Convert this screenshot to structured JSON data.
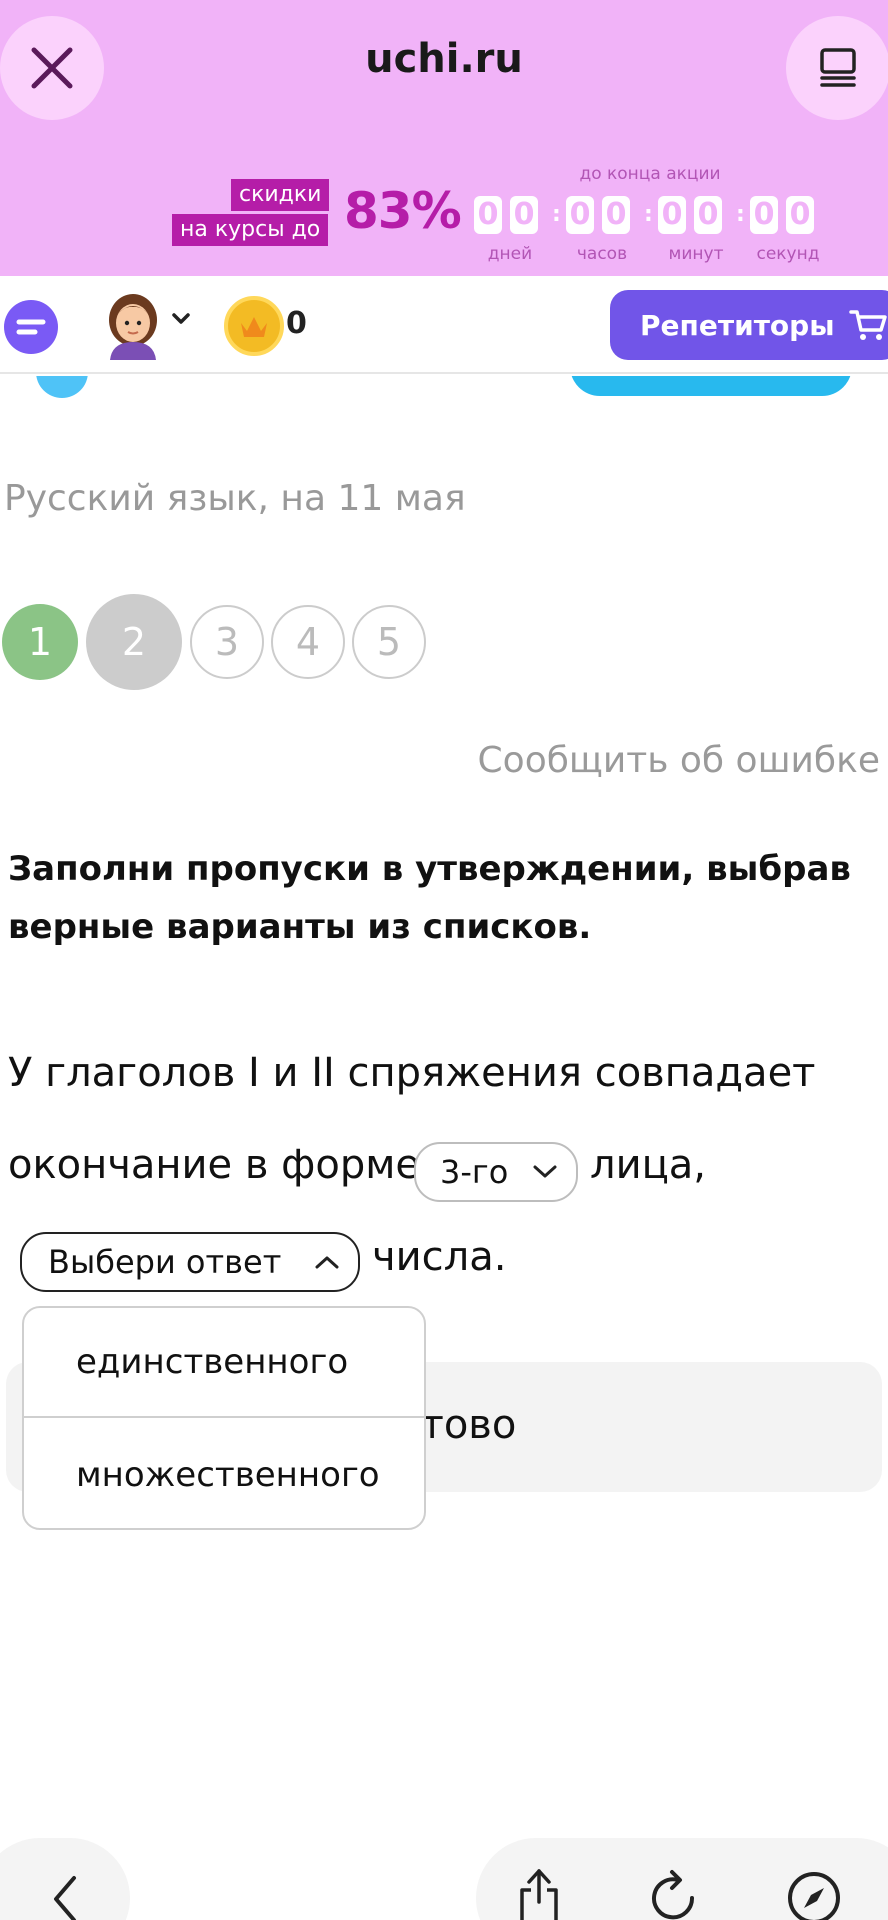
{
  "header": {
    "site": "uchi.ru"
  },
  "promo": {
    "tag_line1": "скидки",
    "tag_line2": "на курсы до",
    "percent": "83%",
    "timer_caption": "до конца акции",
    "digits": [
      "0",
      "0",
      "0",
      "0",
      "0",
      "0",
      "0",
      "0"
    ],
    "units": [
      "дней",
      "часов",
      "минут",
      "секунд"
    ]
  },
  "toolbar": {
    "coins": "0",
    "tutors_label": "Репетиторы"
  },
  "lesson": {
    "title": "Русский язык, на 11 мая",
    "steps": [
      "1",
      "2",
      "3",
      "4",
      "5"
    ],
    "report_link": "Сообщить об ошибке"
  },
  "task": {
    "instruction": "Заполни пропуски в утверждении, выбрав верные варианты из списков.",
    "line1": "У глаголов I и II спряжения совпадает",
    "line2_prefix": "окончание в форме",
    "line2_suffix": "лица,",
    "line3_suffix": "числа.",
    "select1_value": "3-го",
    "select2_placeholder": "Выбери ответ",
    "submit_label": "Готово",
    "dropdown_options": [
      "единственного",
      "множественного"
    ]
  },
  "colors": {
    "banner": "#f1b3f8",
    "promo": "#b51da8",
    "tutors": "#7155e8",
    "step_done": "#8bc486"
  }
}
